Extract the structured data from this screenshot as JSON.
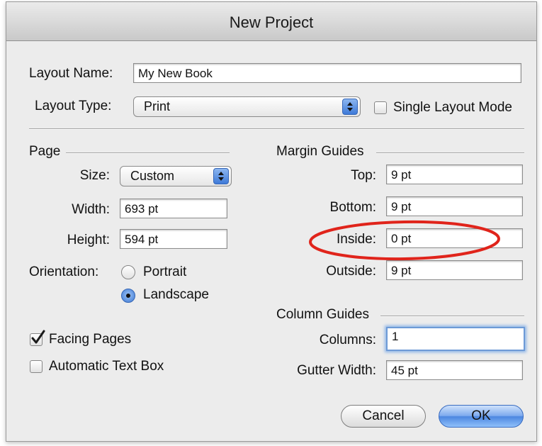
{
  "window": {
    "title": "New Project"
  },
  "layout": {
    "name_label": "Layout Name:",
    "name_value": "My New Book",
    "type_label": "Layout Type:",
    "type_value": "Print",
    "single_layout_label": "Single Layout Mode",
    "single_layout_checked": false
  },
  "page": {
    "section_label": "Page",
    "size_label": "Size:",
    "size_value": "Custom",
    "width_label": "Width:",
    "width_value": "693 pt",
    "height_label": "Height:",
    "height_value": "594 pt",
    "orientation_label": "Orientation:",
    "portrait_label": "Portrait",
    "landscape_label": "Landscape",
    "orientation_selected": "Landscape",
    "facing_pages_label": "Facing Pages",
    "facing_pages_checked": true,
    "auto_text_box_label": "Automatic Text Box",
    "auto_text_box_checked": false
  },
  "margin_guides": {
    "section_label": "Margin Guides",
    "top_label": "Top:",
    "top_value": "9 pt",
    "bottom_label": "Bottom:",
    "bottom_value": "9 pt",
    "inside_label": "Inside:",
    "inside_value": "0 pt",
    "outside_label": "Outside:",
    "outside_value": "9 pt"
  },
  "column_guides": {
    "section_label": "Column Guides",
    "columns_label": "Columns:",
    "columns_value": "1",
    "gutter_label": "Gutter Width:",
    "gutter_value": "45 pt"
  },
  "buttons": {
    "cancel": "Cancel",
    "ok": "OK"
  },
  "colors": {
    "accent": "#4c86e0",
    "annotation": "#e0241b"
  },
  "annotation": {
    "shape": "ellipse",
    "target": "inside-margin-field"
  }
}
